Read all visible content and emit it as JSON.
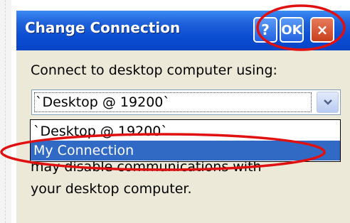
{
  "dialog": {
    "title": "Change Connection",
    "help_label": "?",
    "ok_label": "OK",
    "close_label": "×",
    "prompt": "Connect to desktop computer using:",
    "combo_value": "`Desktop @ 19200`",
    "options": [
      "`Desktop @ 19200`",
      "My Connection"
    ],
    "selected_option": "My Connection",
    "description_line1": "may disable communications with",
    "description_line2": "your desktop computer."
  },
  "colors": {
    "titlebar": "#0a4bd1",
    "dialog_bg": "#ece9d8",
    "selection": "#316ac5",
    "annotation": "#e01010"
  }
}
